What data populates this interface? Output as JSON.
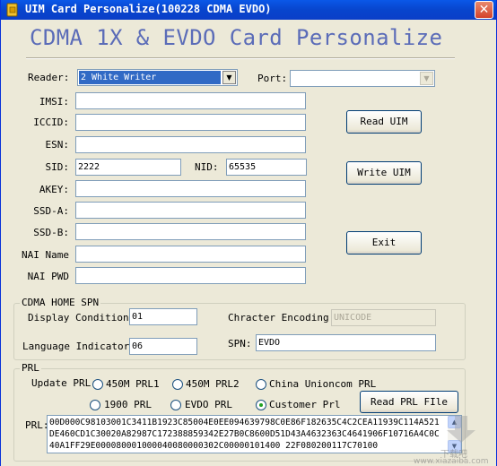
{
  "window": {
    "title": "UIM Card Personalize(100228 CDMA EVDO)",
    "close_glyph": "✕",
    "icon": "sim-card-icon"
  },
  "heading": "CDMA 1X & EVDO Card Personalize",
  "reader": {
    "label": "Reader:",
    "selected": "2 White Writer"
  },
  "port": {
    "label": "Port:",
    "selected": ""
  },
  "fields": {
    "imsi": {
      "label": "IMSI:",
      "value": ""
    },
    "iccid": {
      "label": "ICCID:",
      "value": ""
    },
    "esn": {
      "label": "ESN:",
      "value": ""
    },
    "sid": {
      "label": "SID:",
      "value": "2222"
    },
    "nid": {
      "label": "NID:",
      "value": "65535"
    },
    "akey": {
      "label": "AKEY:",
      "value": ""
    },
    "ssd_a": {
      "label": "SSD-A:",
      "value": ""
    },
    "ssd_b": {
      "label": "SSD-B:",
      "value": ""
    },
    "nai_name": {
      "label": "NAI Name",
      "value": ""
    },
    "nai_pwd": {
      "label": "NAI PWD",
      "value": ""
    }
  },
  "buttons": {
    "read_uim": "Read UIM",
    "write_uim": "Write UIM",
    "exit": "Exit",
    "read_prl_file": "Read PRL FIle"
  },
  "spn_group": {
    "title": "CDMA HOME SPN",
    "display_condition_label": "Display Condition:",
    "display_condition": "01",
    "char_encoding_label": "Chracter Encoding:",
    "char_encoding": "UNICODE",
    "language_indicator_label": "Language Indicator:",
    "language_indicator": "06",
    "spn_label": "SPN:",
    "spn": "EVDO"
  },
  "prl_group": {
    "title": "PRL",
    "update_label": "Update PRL:",
    "options": [
      "450M PRL1",
      "450M PRL2",
      "China Unioncom PRL",
      "1900 PRL",
      "EVDO PRL",
      "Customer Prl"
    ],
    "selected_index": 5,
    "prl_label": "PRL:",
    "prl_data": "00D000C98103001C3411B1923C85004E0EE094639798C0E86F182635C4C2CEA11939C114A521DE460CD1C30020A82987C172388859342E27B0C8600D51D43A4632363C4641906F10716A4C0C40A1FF29E000080001000040080000302C00000101400 22F080200117C70100"
  },
  "watermark": {
    "brand": "下载吧",
    "url": "www.xiazaiba.com"
  }
}
